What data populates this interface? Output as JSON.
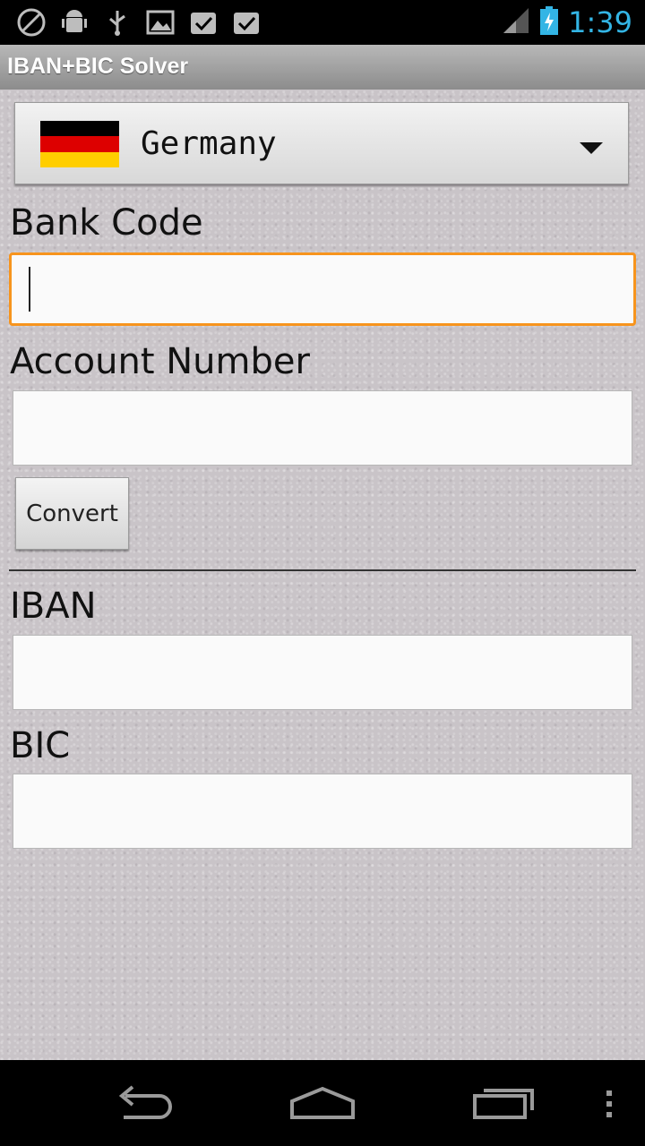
{
  "status_bar": {
    "time": "1:39",
    "icons": [
      "blocked-icon",
      "android-debug-icon",
      "usb-icon",
      "picture-icon",
      "download-done-icon",
      "download-done-icon",
      "signal-icon",
      "battery-charging-icon"
    ]
  },
  "app": {
    "title": "IBAN+BIC Solver"
  },
  "country": {
    "selected": "Germany",
    "flag_colors": [
      "#000000",
      "#dd0000",
      "#ffce00"
    ]
  },
  "form": {
    "bank_code_label": "Bank Code",
    "bank_code_value": "",
    "account_number_label": "Account Number",
    "account_number_value": "",
    "convert_label": "Convert",
    "iban_label": "IBAN",
    "iban_value": "",
    "bic_label": "BIC",
    "bic_value": ""
  },
  "colors": {
    "focus": "#f7941d",
    "clock": "#33b5e5"
  },
  "nav": {
    "buttons": [
      "back-icon",
      "home-icon",
      "recents-icon",
      "overflow-menu-icon"
    ]
  }
}
